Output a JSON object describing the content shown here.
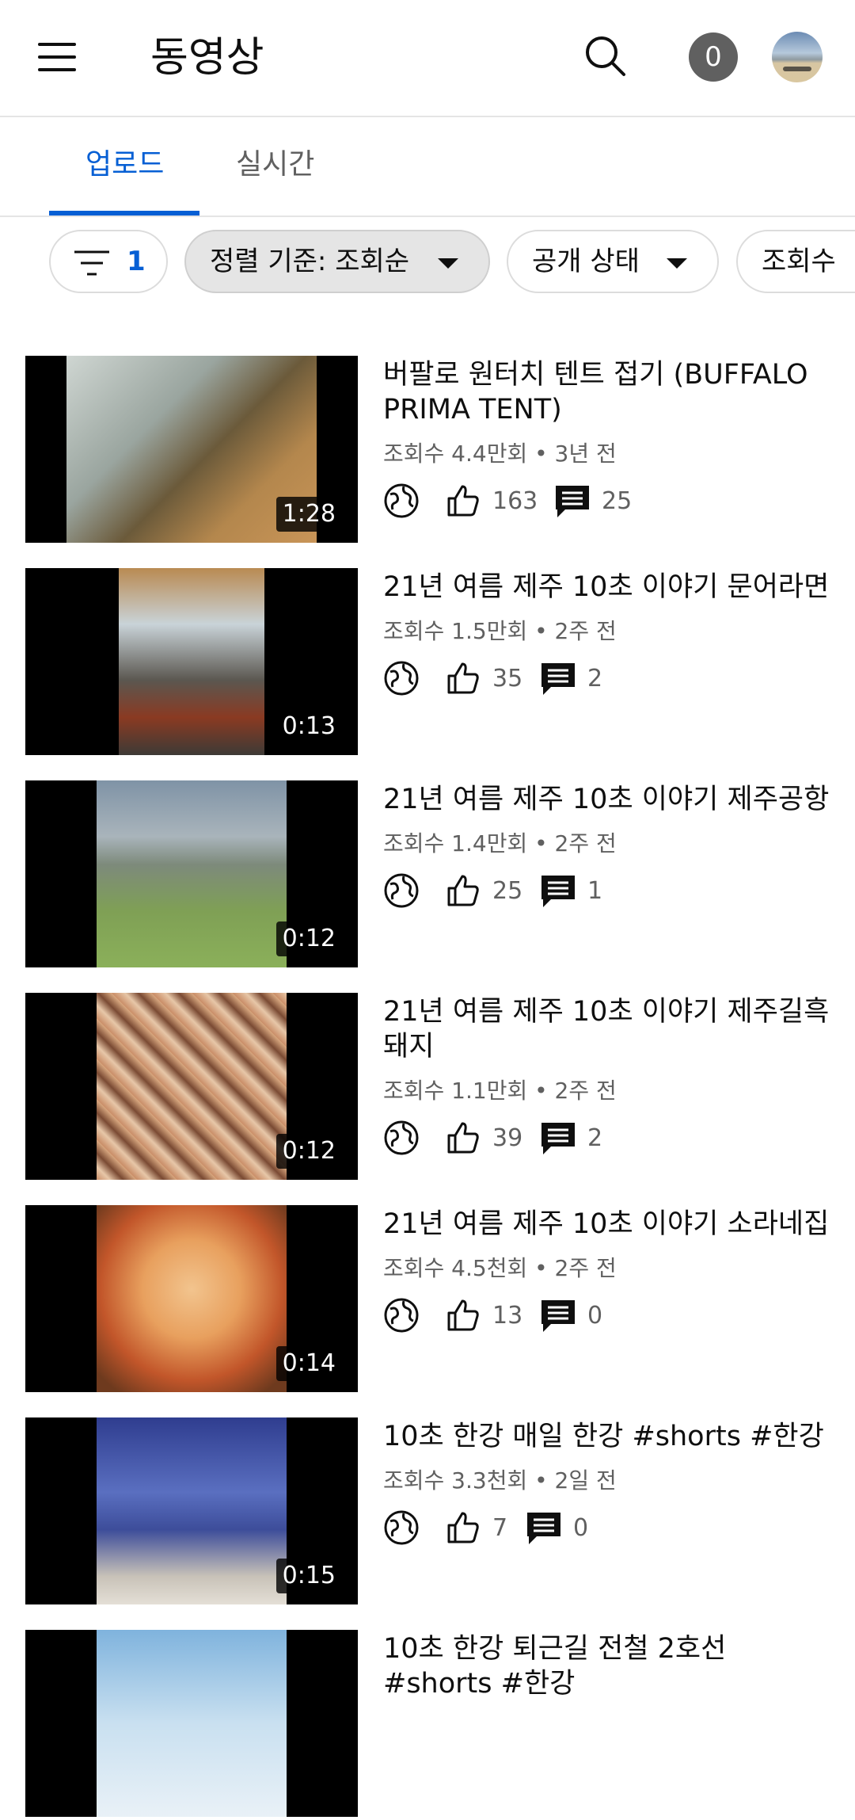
{
  "header": {
    "title": "동영상",
    "notification_count": "0",
    "menu_icon": "hamburger-menu-icon",
    "search_icon": "search-icon"
  },
  "tabs": [
    {
      "label": "업로드",
      "active": true
    },
    {
      "label": "실시간",
      "active": false
    }
  ],
  "filters": {
    "filter_count": "1",
    "sort_label": "정렬 기준: 조회순",
    "visibility_label": "공개 상태",
    "views_label": "조회수"
  },
  "colors": {
    "accent": "#065fd4",
    "text": "#0f0f0f",
    "muted": "#606060"
  },
  "videos": [
    {
      "title": "버팔로 원터치 텐트 접기 (BUFFALO PRIMA TENT)",
      "meta": "조회수 4.4만회 • 3년 전",
      "likes": "163",
      "comments": "25",
      "duration": "1:28"
    },
    {
      "title": "21년 여름 제주 10초 이야기 문어라면",
      "meta": "조회수 1.5만회 • 2주 전",
      "likes": "35",
      "comments": "2",
      "duration": "0:13"
    },
    {
      "title": "21년 여름 제주 10초 이야기 제주공항",
      "meta": "조회수 1.4만회 • 2주 전",
      "likes": "25",
      "comments": "1",
      "duration": "0:12"
    },
    {
      "title": "21년 여름 제주 10초 이야기 제주길흑돼지",
      "meta": "조회수 1.1만회 • 2주 전",
      "likes": "39",
      "comments": "2",
      "duration": "0:12"
    },
    {
      "title": "21년 여름 제주 10초 이야기 소라네집",
      "meta": "조회수 4.5천회 • 2주 전",
      "likes": "13",
      "comments": "0",
      "duration": "0:14"
    },
    {
      "title": "10초 한강 매일 한강 #shorts #한강",
      "meta": "조회수 3.3천회 • 2일 전",
      "likes": "7",
      "comments": "0",
      "duration": "0:15"
    },
    {
      "title": "10초 한강 퇴근길 전철 2호선 #shorts #한강",
      "meta": "",
      "likes": "",
      "comments": "",
      "duration": ""
    }
  ]
}
